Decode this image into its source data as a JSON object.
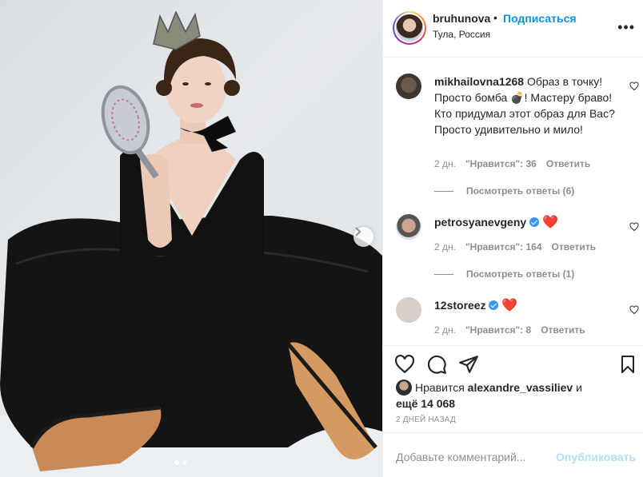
{
  "post": {
    "photo_alt": "",
    "carousel": {
      "count": 2,
      "active": 1
    }
  },
  "header": {
    "username": "bruhunova",
    "dot": "•",
    "follow_label": "Подписаться",
    "location": "Тула, Россия",
    "more_label": "•••"
  },
  "comments": [
    {
      "username": "mikhailovna1268",
      "text_parts": [
        "Образ в точку! Просто бомба ",
        "! Мастеру браво! Кто придумал этот образ для Вас? Просто удивительно и мило!"
      ],
      "emoji": "💣",
      "time": "2 дн.",
      "likes": "\"Нравится\": 36",
      "reply": "Ответить",
      "view_replies": "Посмотреть ответы (6)"
    },
    {
      "username": "petrosyanevgeny",
      "verified": true,
      "emoji": "❤️",
      "time": "2 дн.",
      "likes": "\"Нравится\": 164",
      "reply": "Ответить",
      "view_replies": "Посмотреть ответы (1)"
    },
    {
      "username": "12storeez",
      "verified": true,
      "emoji": "❤️",
      "time": "2 дн.",
      "likes": "\"Нравится\": 8",
      "reply": "Ответить"
    }
  ],
  "likes": {
    "prefix": "Нравится",
    "user": "alexandre_vassiliev",
    "joiner": "и",
    "more": "ещё 14 068"
  },
  "date": "2 ДНЕЙ НАЗАД",
  "add_comment": {
    "placeholder": "Добавьте комментарий...",
    "post_label": "Опубликовать"
  },
  "icons": {
    "like": "heart-icon",
    "comment": "comment-icon",
    "share": "paper-plane-icon",
    "save": "bookmark-icon",
    "next": "chevron-right-icon"
  },
  "colors": {
    "accent": "#0095f6",
    "post_disabled": "#b2dffc",
    "muted": "#8e8e8e",
    "heart_red": "#ed1c24"
  }
}
